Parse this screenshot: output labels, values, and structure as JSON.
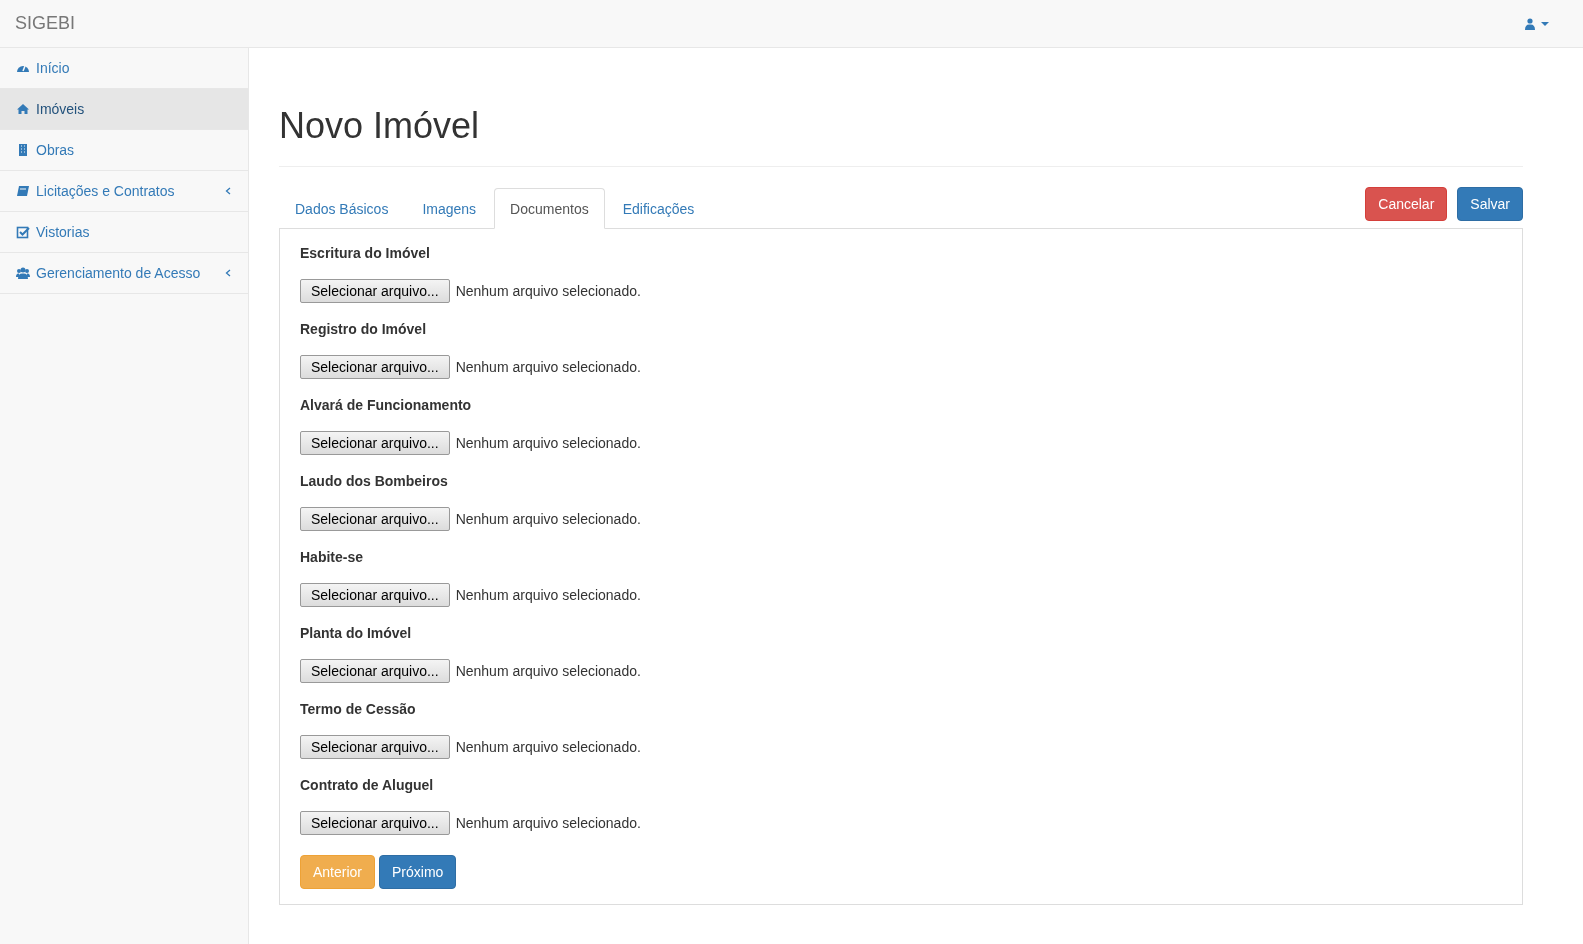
{
  "brand": "SIGEBI",
  "sidebar": {
    "items": [
      {
        "label": "Início",
        "selected": false,
        "expandable": false
      },
      {
        "label": "Imóveis",
        "selected": true,
        "expandable": false
      },
      {
        "label": "Obras",
        "selected": false,
        "expandable": false
      },
      {
        "label": "Licitações e Contratos",
        "selected": false,
        "expandable": true
      },
      {
        "label": "Vistorias",
        "selected": false,
        "expandable": false
      },
      {
        "label": "Gerenciamento de Acesso",
        "selected": false,
        "expandable": true
      }
    ]
  },
  "page_title": "Novo Imóvel",
  "tabs": [
    {
      "label": "Dados Básicos",
      "selected": false
    },
    {
      "label": "Imagens",
      "selected": false
    },
    {
      "label": "Documentos",
      "selected": true
    },
    {
      "label": "Edificações",
      "selected": false
    }
  ],
  "actions": {
    "cancel": "Cancelar",
    "save": "Salvar"
  },
  "documents": [
    {
      "label": "Escritura do Imóvel",
      "button": "Selecionar arquivo...",
      "status": "Nenhum arquivo selecionado."
    },
    {
      "label": "Registro do Imóvel",
      "button": "Selecionar arquivo...",
      "status": "Nenhum arquivo selecionado."
    },
    {
      "label": "Alvará de Funcionamento",
      "button": "Selecionar arquivo...",
      "status": "Nenhum arquivo selecionado."
    },
    {
      "label": "Laudo dos Bombeiros",
      "button": "Selecionar arquivo...",
      "status": "Nenhum arquivo selecionado."
    },
    {
      "label": "Habite-se",
      "button": "Selecionar arquivo...",
      "status": "Nenhum arquivo selecionado."
    },
    {
      "label": "Planta do Imóvel",
      "button": "Selecionar arquivo...",
      "status": "Nenhum arquivo selecionado."
    },
    {
      "label": "Termo de Cessão",
      "button": "Selecionar arquivo...",
      "status": "Nenhum arquivo selecionado."
    },
    {
      "label": "Contrato de Aluguel",
      "button": "Selecionar arquivo...",
      "status": "Nenhum arquivo selecionado."
    }
  ],
  "nav_buttons": {
    "previous": "Anterior",
    "next": "Próximo"
  }
}
